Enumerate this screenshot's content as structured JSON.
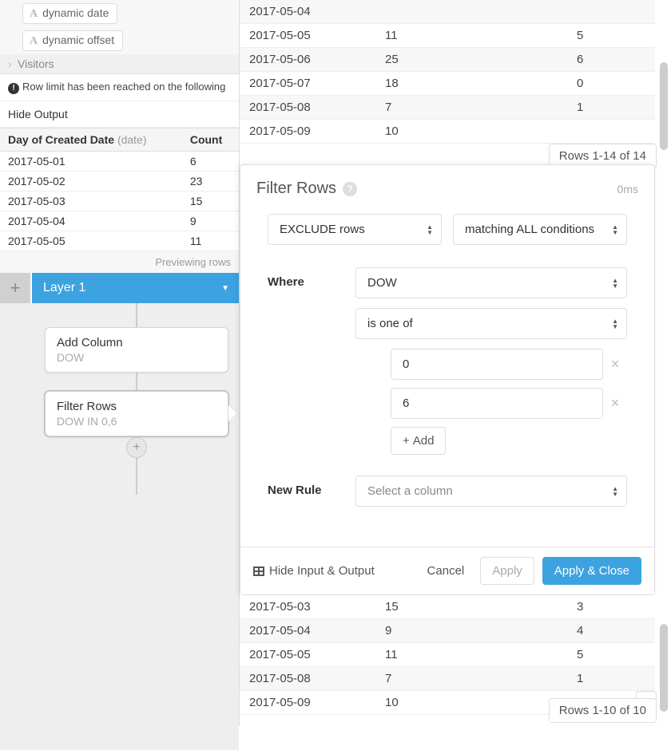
{
  "left": {
    "pills": [
      "dynamic date",
      "dynamic offset"
    ],
    "visitors_label": "Visitors",
    "alert_text": "Row limit has been reached on the following",
    "hide_output": "Hide Output",
    "table": {
      "col1": "Day of Created Date",
      "col1_sub": "(date)",
      "col2": "Count",
      "rows": [
        {
          "d": "2017-05-01",
          "c": "6"
        },
        {
          "d": "2017-05-02",
          "c": "23"
        },
        {
          "d": "2017-05-03",
          "c": "15"
        },
        {
          "d": "2017-05-04",
          "c": "9"
        },
        {
          "d": "2017-05-05",
          "c": "11"
        }
      ]
    },
    "preview_label": "Previewing rows",
    "layer_label": "Layer 1",
    "nodes": {
      "add_col": {
        "title": "Add Column",
        "sub": "DOW"
      },
      "filter": {
        "title": "Filter Rows",
        "sub": "DOW IN 0,6"
      }
    }
  },
  "right_top": {
    "rows": [
      {
        "d": "2017-05-04",
        "c": "",
        "e": ""
      },
      {
        "d": "2017-05-05",
        "c": "11",
        "e": "5"
      },
      {
        "d": "2017-05-06",
        "c": "25",
        "e": "6"
      },
      {
        "d": "2017-05-07",
        "c": "18",
        "e": "0"
      },
      {
        "d": "2017-05-08",
        "c": "7",
        "e": "1"
      },
      {
        "d": "2017-05-09",
        "c": "10",
        "e": ""
      }
    ],
    "rows_label": "Rows 1-14 of 14"
  },
  "filter": {
    "title": "Filter Rows",
    "time": "0ms",
    "mode": "EXCLUDE rows",
    "match": "matching ALL conditions",
    "where_label": "Where",
    "column": "DOW",
    "operator": "is one of",
    "values": [
      "0",
      "6"
    ],
    "add_label": "Add",
    "new_rule_label": "New Rule",
    "new_rule_placeholder": "Select a column",
    "hide_io": "Hide Input & Output",
    "cancel": "Cancel",
    "apply": "Apply",
    "apply_close": "Apply & Close"
  },
  "right_bottom": {
    "rows": [
      {
        "d": "2017-05-03",
        "c": "15",
        "e": "3"
      },
      {
        "d": "2017-05-04",
        "c": "9",
        "e": "4"
      },
      {
        "d": "2017-05-05",
        "c": "11",
        "e": "5"
      },
      {
        "d": "2017-05-08",
        "c": "7",
        "e": "1"
      },
      {
        "d": "2017-05-09",
        "c": "10",
        "e": ""
      }
    ],
    "rows_label": "Rows 1-10 of 10"
  }
}
